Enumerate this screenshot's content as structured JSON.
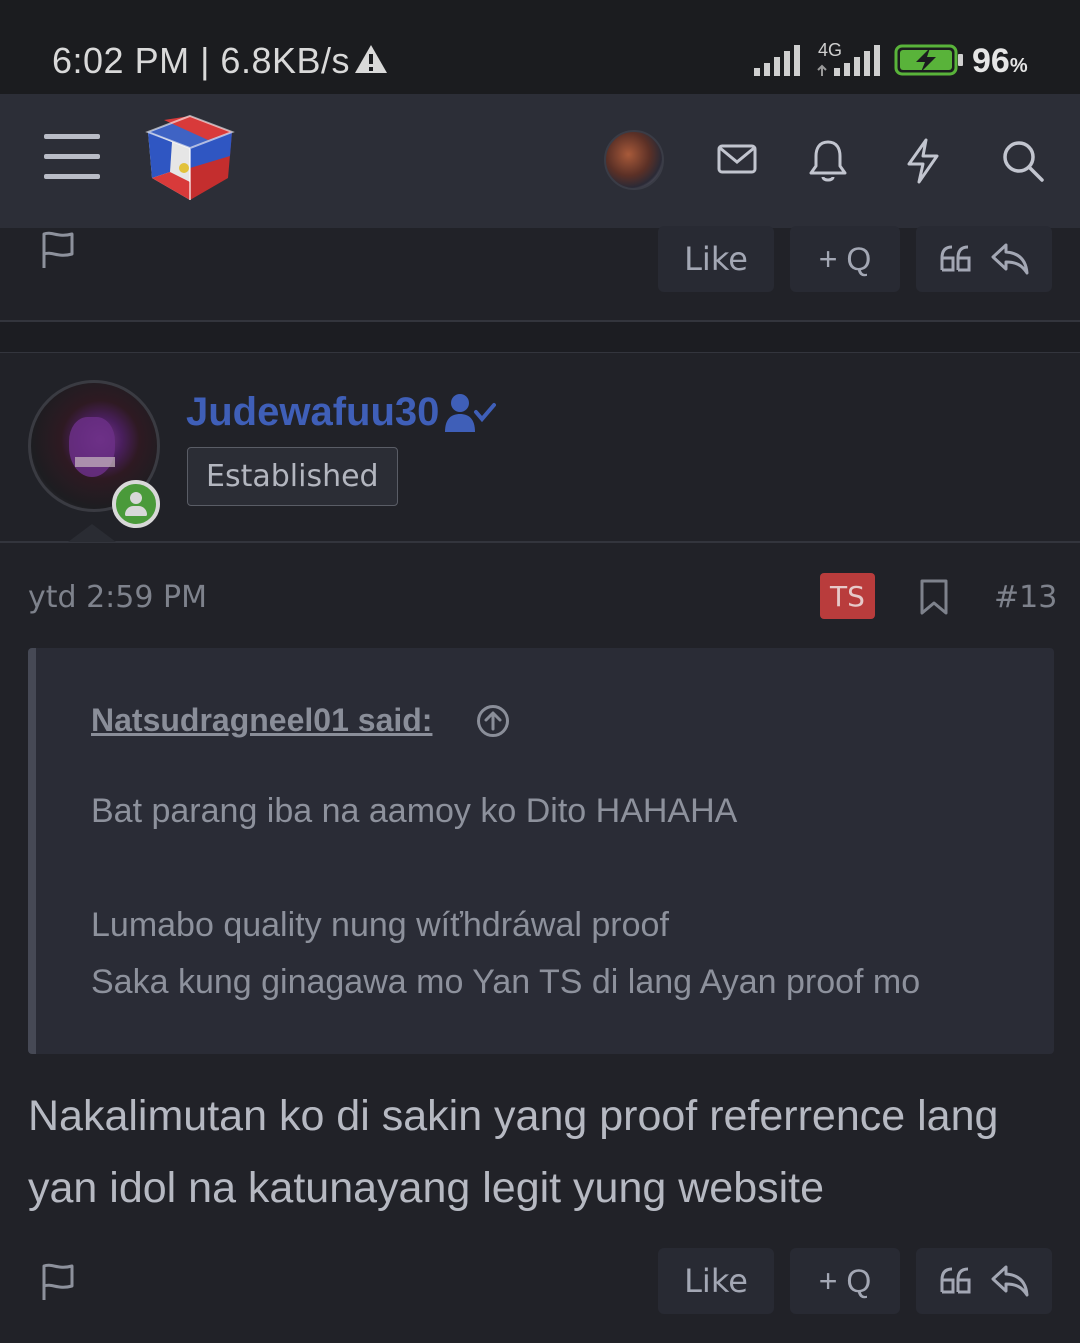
{
  "status_bar": {
    "time": "6:02 PM | 6.8KB/s",
    "network": "4G",
    "battery": "96",
    "battery_unit": "%"
  },
  "header": {
    "icons": [
      "menu-icon",
      "site-logo",
      "user-avatar",
      "mail-icon",
      "bell-icon",
      "lightning-icon",
      "search-icon"
    ]
  },
  "prev_post_footer": {
    "like_label": "Like",
    "quote_add_label": "+ Q"
  },
  "post": {
    "username": "Judewafuu30",
    "role": "Established",
    "time": "ytd 2:59 PM",
    "ts_badge": "TS",
    "number": "#13",
    "quote": {
      "author": "Natsudragneel01 said:",
      "lines": [
        "Bat parang iba na aamoy ko Dito HAHAHA",
        "Lumabo quality nung wíťhdráwal proof",
        "Saka kung ginagawa mo Yan TS di lang Ayan proof mo"
      ]
    },
    "body": "Nakalimutan ko di sakin yang proof referrence lang yan idol na katunayang legit yung website"
  },
  "post_footer": {
    "like_label": "Like",
    "quote_add_label": "+ Q"
  }
}
